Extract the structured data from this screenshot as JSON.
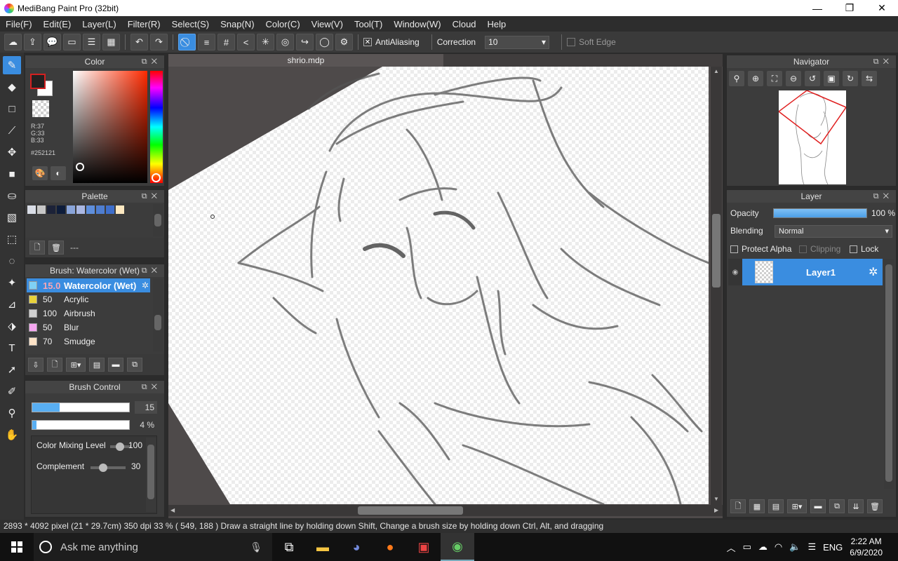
{
  "window": {
    "title": "MediBang Paint Pro (32bit)",
    "controls": {
      "minimize": "—",
      "maximize": "❐",
      "close": "✕"
    }
  },
  "menu": [
    "File(F)",
    "Edit(E)",
    "Layer(L)",
    "Filter(R)",
    "Select(S)",
    "Snap(N)",
    "Color(C)",
    "View(V)",
    "Tool(T)",
    "Window(W)",
    "Cloud",
    "Help"
  ],
  "toolbar": {
    "antialiasing_label": "AntiAliasing",
    "antialiasing_checked": true,
    "correction_label": "Correction",
    "correction_value": "10",
    "soft_edge_label": "Soft Edge",
    "soft_edge_checked": false
  },
  "color_panel": {
    "title": "Color",
    "r": "R:37",
    "g": "G:33",
    "b": "B:33",
    "hex": "#252121",
    "foreground": "#252121",
    "background": "#ffffff"
  },
  "palette_panel": {
    "title": "Palette",
    "swatches": [
      "#d9dde6",
      "#c7c7c7",
      "#1c2238",
      "#0d1c3a",
      "#8aa5da",
      "#aab8e3",
      "#5f8fdc",
      "#4f7ed0",
      "#3f6fcb",
      "#fde8c1"
    ],
    "name": "---"
  },
  "brush_panel": {
    "title": "Brush: Watercolor (Wet)",
    "brushes": [
      {
        "size": "15.0",
        "name": "Watercolor (Wet)",
        "color": "#7fd0f5"
      },
      {
        "size": "50",
        "name": "Acrylic",
        "color": "#e8d23a"
      },
      {
        "size": "100",
        "name": "Airbrush",
        "color": "#d0d0d0"
      },
      {
        "size": "50",
        "name": "Blur",
        "color": "#f5a6f0"
      },
      {
        "size": "70",
        "name": "Smudge",
        "color": "#fde2c6"
      }
    ]
  },
  "brush_control": {
    "title": "Brush Control",
    "size_value": "15",
    "size_fraction": 0.28,
    "opacity_value": "4 %",
    "opacity_fraction": 0.04,
    "color_mixing_label": "Color Mixing Level",
    "color_mixing_value": "100",
    "complement_label": "Complement",
    "complement_value": "30"
  },
  "canvas": {
    "tab_name": "shrio.mdp"
  },
  "navigator": {
    "title": "Navigator"
  },
  "layer_panel": {
    "title": "Layer",
    "opacity_label": "Opacity",
    "opacity_value": "100 %",
    "blending_label": "Blending",
    "blending_value": "Normal",
    "protect_alpha_label": "Protect Alpha",
    "clipping_label": "Clipping",
    "lock_label": "Lock",
    "layers": [
      {
        "name": "Layer1"
      }
    ]
  },
  "status": {
    "text": "2893 * 4092 pixel   (21 * 29.7cm)   350 dpi   33 %   ( 549, 188 )   Draw a straight line by holding down Shift, Change a brush size by holding down Ctrl, Alt, and dragging"
  },
  "taskbar": {
    "search_placeholder": "Ask me anything",
    "language": "ENG",
    "time": "2:22 AM",
    "date": "6/9/2020"
  }
}
